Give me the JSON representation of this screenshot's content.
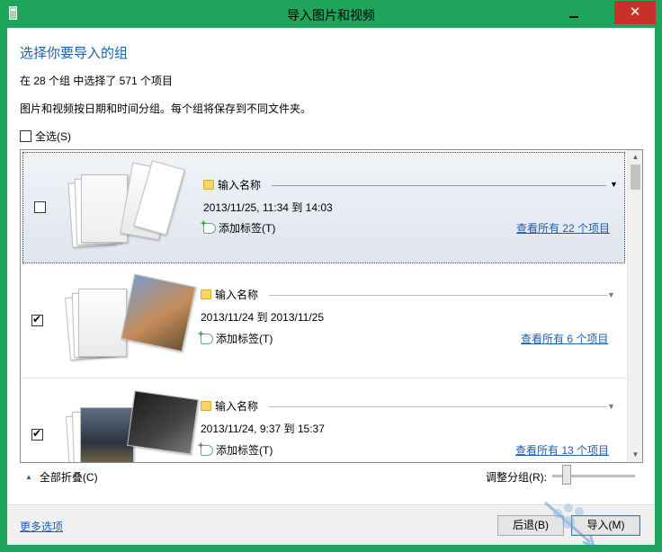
{
  "window": {
    "title": "导入图片和视频"
  },
  "heading": "选择你要导入的组",
  "summary": "在 28 个组 中选择了 571 个项目",
  "description": "图片和视频按日期和时间分组。每个组将保存到不同文件夹。",
  "select_all_label": "全选(S)",
  "groups": [
    {
      "checked": false,
      "name_placeholder": "输入名称",
      "date_range": "2013/11/25, 11:34 到 14:03",
      "add_tag": "添加标签(T)",
      "view_all": "查看所有 22 个项目"
    },
    {
      "checked": true,
      "name_placeholder": "输入名称",
      "date_range": "2013/11/24 到 2013/11/25",
      "add_tag": "添加标签(T)",
      "view_all": "查看所有 6 个项目"
    },
    {
      "checked": true,
      "name_placeholder": "输入名称",
      "date_range": "2013/11/24, 9:37 到 15:37",
      "add_tag": "添加标签(T)",
      "view_all": "查看所有 13 个项目"
    }
  ],
  "collapse_all": "全部折叠(C)",
  "adjust_grouping": "调整分组(R):",
  "more_options": "更多选项",
  "buttons": {
    "back": "后退(B)",
    "import": "导入(M)"
  },
  "colors": {
    "frame": "#1fa45b",
    "close": "#c7312a",
    "link": "#1f5ea8"
  }
}
